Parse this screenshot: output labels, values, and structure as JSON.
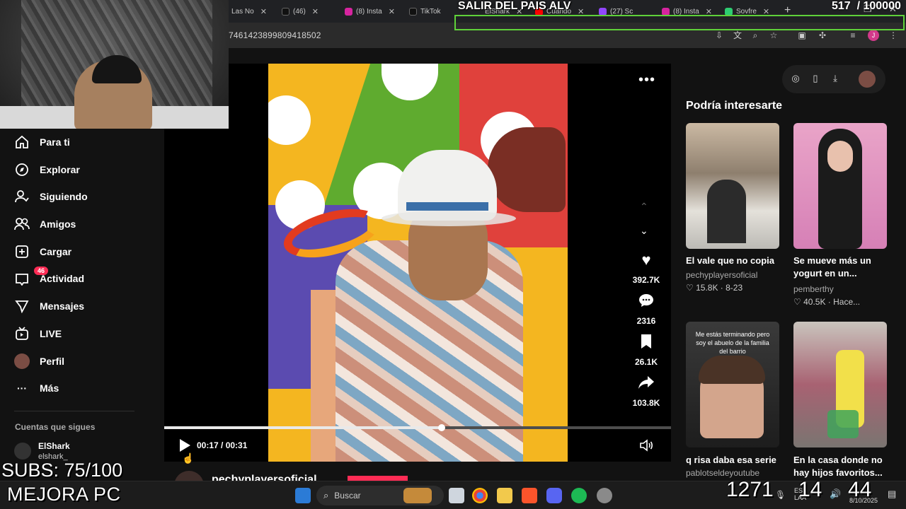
{
  "browser": {
    "tabs": [
      {
        "label": "Las No",
        "color": "#3a3a3a"
      },
      {
        "label": "(46)",
        "color": "#111111"
      },
      {
        "label": "(8) Insta",
        "color": "#d6249f"
      },
      {
        "label": "TikTok",
        "color": "#111111"
      },
      {
        "label": "ElShark",
        "color": "#555555"
      },
      {
        "label": "Cuando",
        "color": "#ff0000"
      },
      {
        "label": "(27) Sc",
        "color": "#9146ff"
      },
      {
        "label": "(8) Insta",
        "color": "#d6249f"
      },
      {
        "label": "Sovfre",
        "color": "#2ecc71"
      }
    ],
    "url": "7461423899809418502"
  },
  "overlay": {
    "title": "SALIR DEL PAIS ALV",
    "counter": "517  / 100000",
    "subs": "SUBS: 75/100",
    "mejora": "MEJORA PC",
    "big_left": "1271",
    "big_mid": "14",
    "big_right": "44"
  },
  "sidebar": {
    "items": [
      {
        "label": "Para ti",
        "icon": "home-icon"
      },
      {
        "label": "Explorar",
        "icon": "compass-icon"
      },
      {
        "label": "Siguiendo",
        "icon": "following-icon"
      },
      {
        "label": "Amigos",
        "icon": "friends-icon"
      },
      {
        "label": "Cargar",
        "icon": "upload-icon"
      },
      {
        "label": "Actividad",
        "icon": "inbox-icon"
      },
      {
        "label": "Mensajes",
        "icon": "messages-icon"
      },
      {
        "label": "LIVE",
        "icon": "live-icon"
      },
      {
        "label": "Perfil",
        "icon": "profile-icon"
      },
      {
        "label": "Más",
        "icon": "more-icon"
      }
    ],
    "activity_badge": "46",
    "following_title": "Cuentas que sigues",
    "account_name": "ElShark",
    "account_handle": "elshark_"
  },
  "video": {
    "likes": "392.7K",
    "comments": "2316",
    "saves": "26.1K",
    "shares": "103.8K",
    "time": "00:17 / 00:31",
    "progress": 0.548,
    "author": "pechyplayersoficial"
  },
  "recommendations": {
    "title": "Podría interesarte",
    "cards": [
      {
        "title": "El vale que no copia",
        "user": "pechyplayersoficial",
        "meta": "♡ 15.8K · 8-23",
        "thumb_text": ""
      },
      {
        "title": "Se mueve más un yogurt en un...",
        "user": "pemberthy",
        "meta": "♡ 40.5K · Hace...",
        "thumb_text": ""
      },
      {
        "title": "q risa daba esa serie",
        "user": "pablotseldeyoutube",
        "meta": "",
        "thumb_text": "Me estás terminando pero soy el abuelo de la familia del barrio"
      },
      {
        "title": "En la casa donde no hay hijos favoritos...",
        "user": "",
        "meta": "",
        "thumb_text": ""
      }
    ]
  },
  "taskbar": {
    "search_label": "Buscar",
    "tray_lang": "ESP\nLAA",
    "date": "8/10/2025"
  },
  "colors": {
    "accent": "#fe2c55",
    "green_box": "#5fd13a"
  }
}
